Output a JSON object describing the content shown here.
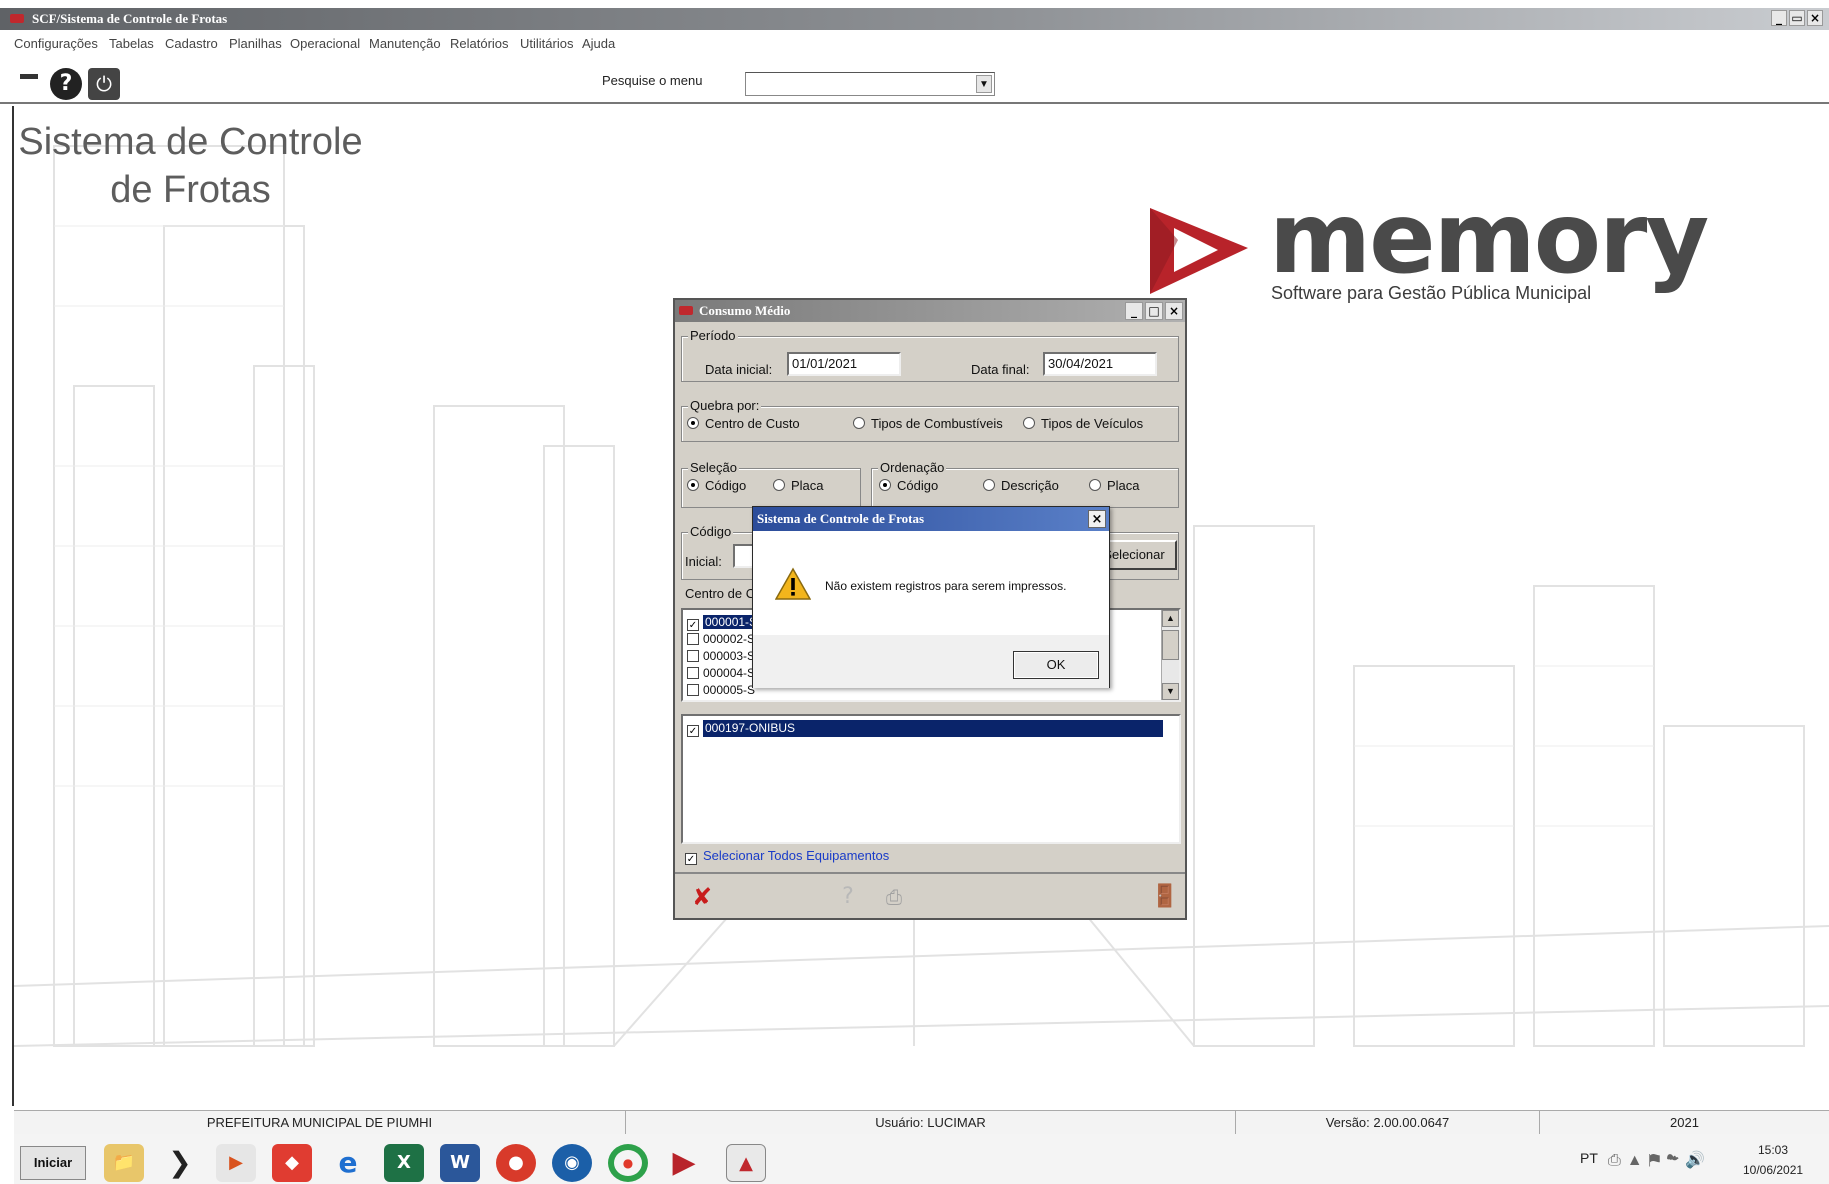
{
  "window": {
    "title": "SCF/Sistema de Controle de Frotas"
  },
  "menu": [
    "Configurações",
    "Tabelas",
    "Cadastro",
    "Planilhas",
    "Operacional",
    "Manutenção",
    "Relatórios",
    "Utilitários",
    "Ajuda"
  ],
  "toolbar": {
    "search_label": "Pesquise o menu",
    "search_value": ""
  },
  "background": {
    "title_line1": "Sistema de Controle",
    "title_line2": "de Frotas"
  },
  "logo": {
    "word": "memory",
    "tagline": "Software para Gestão Pública Municipal",
    "color": "#c0282d"
  },
  "consumo": {
    "title": "Consumo Médio",
    "periodo_legend": "Período",
    "data_inicial_label": "Data inicial:",
    "data_inicial_value": "01/01/2021",
    "data_final_label": "Data final:",
    "data_final_value": "30/04/2021",
    "quebra_legend": "Quebra por:",
    "quebra_options": [
      "Centro de Custo",
      "Tipos de Combustíveis",
      "Tipos de Veículos"
    ],
    "quebra_selected": "Centro de Custo",
    "selecao_legend": "Seleção",
    "selecao_options": [
      "Código",
      "Placa"
    ],
    "ordenacao_legend": "Ordenação",
    "ordenacao_options": [
      "Código",
      "Descrição",
      "Placa"
    ],
    "codigo_legend": "Código",
    "inicial_label": "Inicial:",
    "selecionar_label": "Selecionar",
    "centro_label": "Centro de Cu",
    "centro_items": [
      {
        "text": "000001-S",
        "checked": true,
        "selected": true
      },
      {
        "text": "000002-S",
        "checked": false,
        "selected": false
      },
      {
        "text": "000003-S",
        "checked": false,
        "selected": false
      },
      {
        "text": "000004-S",
        "checked": false,
        "selected": false
      },
      {
        "text": "000005-S",
        "checked": false,
        "selected": false
      }
    ],
    "equip_items": [
      {
        "text": "000197-ONIBUS",
        "checked": true,
        "selected": true
      }
    ],
    "select_all_label": "Selecionar Todos Equipamentos",
    "select_all_checked": true
  },
  "dialog": {
    "title": "Sistema de Controle de Frotas",
    "message": "Não existem registros para serem impressos.",
    "ok_label": "OK"
  },
  "status": {
    "org": "PREFEITURA MUNICIPAL DE PIUMHI",
    "user": "Usuário: LUCIMAR",
    "version": "Versão: 2.00.00.0647",
    "year": "2021"
  },
  "taskbar": {
    "start_label": "Iniciar",
    "lang": "PT",
    "time": "15:03",
    "date": "10/06/2021"
  }
}
